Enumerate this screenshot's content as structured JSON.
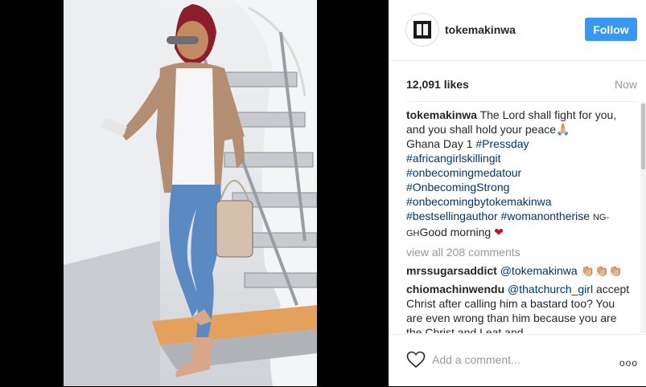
{
  "post": {
    "username": "tokemakinwa",
    "follow_label": "Follow",
    "likes": "12,091 likes",
    "time": "Now"
  },
  "caption": {
    "user": "tokemakinwa",
    "text": "The Lord shall fight for you, and you shall hold your peace",
    "emoji": "🙏🏼",
    "line2": "Ghana Day 1",
    "tags": [
      "#Pressday",
      "#africangirlskillingit",
      "#onbecomingmedatour",
      "#OnbecomingStrong",
      "#onbecomingbytokemakinwa",
      "#bestsellingauthor",
      "#womanontherise"
    ],
    "location": "NG-GH",
    "end": "Good morning",
    "heart_emoji": "❤"
  },
  "view_all": "view all 208 comments",
  "comments": [
    {
      "user": "mrssugarsaddict",
      "mention": "@tokemakinwa",
      "emoji": "👏🏼👏🏼👏🏼"
    },
    {
      "user": "chiomachinwendu",
      "mention": "@thatchurch_girl",
      "text": "accept Christ after calling him a bastard too? You are even wrong than him because you are the Christ and I eat and"
    }
  ],
  "add_comment": {
    "placeholder": "Add a comment..."
  },
  "more_label": "ooo",
  "colors": {
    "accent": "#3897f0",
    "link": "#003569",
    "muted": "#999999",
    "heart": "#ed4956"
  },
  "icons": [
    "avatar-logo-icon",
    "heart-outline-icon",
    "more-options-icon"
  ]
}
